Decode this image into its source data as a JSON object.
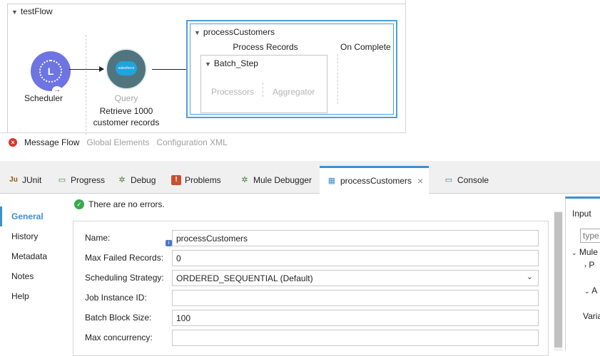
{
  "canvas": {
    "flow_name": "testFlow",
    "scheduler_label": "Scheduler",
    "scheduler_letter": "L",
    "salesforce_text": "salesforce",
    "query_label": "Query",
    "query_description_line1": "Retrieve 1000",
    "query_description_line2": "customer records",
    "batch_name": "processCustomers",
    "process_records": "Process Records",
    "on_complete": "On Complete",
    "batch_step": "Batch_Step",
    "processors": "Processors",
    "aggregator": "Aggregator"
  },
  "view_tabs": [
    "Message Flow",
    "Global Elements",
    "Configuration XML"
  ],
  "tabs": [
    {
      "label": "JUnit",
      "icon": "Ju"
    },
    {
      "label": "Progress",
      "icon": "▭"
    },
    {
      "label": "Debug",
      "icon": "✲"
    },
    {
      "label": "Problems",
      "icon": "!"
    },
    {
      "label": "Mule Debugger",
      "icon": "✲"
    },
    {
      "label": "processCustomers",
      "icon": "▦"
    },
    {
      "label": "Console",
      "icon": "▭"
    }
  ],
  "side_nav": [
    "General",
    "History",
    "Metadata",
    "Notes",
    "Help"
  ],
  "status": "There are no errors.",
  "form": {
    "name_label": "Name:",
    "name_value": "processCustomers",
    "max_failed_label": "Max Failed Records:",
    "max_failed_value": "0",
    "strategy_label": "Scheduling Strategy:",
    "strategy_value": "ORDERED_SEQUENTIAL (Default)",
    "job_id_label": "Job Instance ID:",
    "job_id_value": "",
    "block_size_label": "Batch Block Size:",
    "block_size_value": "100",
    "concurrency_label": "Max concurrency:",
    "concurrency_value": ""
  },
  "input_panel": {
    "title": "Input",
    "search_placeholder": "type",
    "tree": [
      "Mule",
      "P",
      "A",
      "Varia"
    ]
  },
  "colors": {
    "accent": "#3d8fd0",
    "scheduler": "#6f74e3",
    "salesforce_node": "#51757f",
    "error": "#d9352b",
    "ok": "#3aa94c"
  }
}
